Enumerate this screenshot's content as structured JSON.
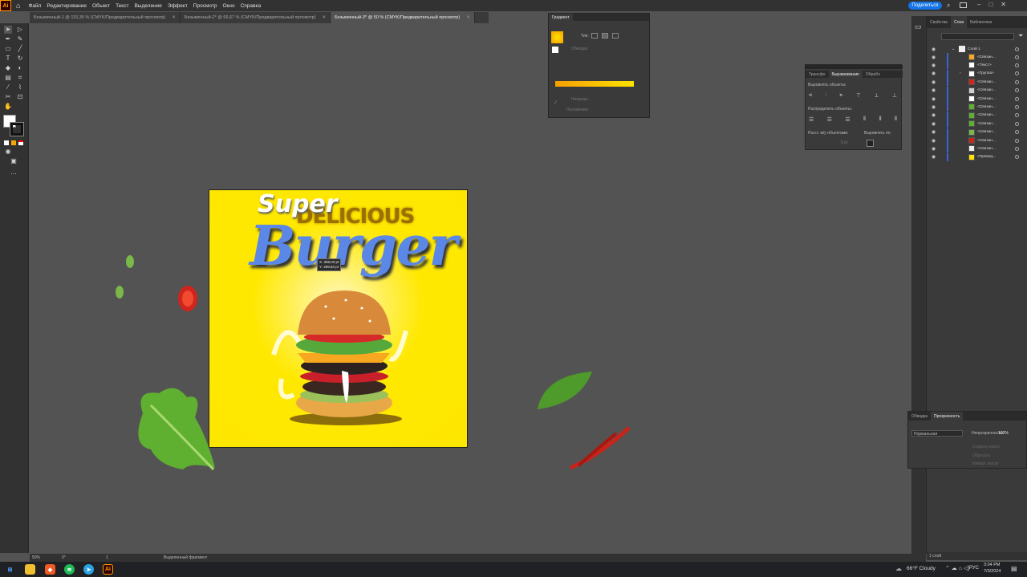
{
  "app": {
    "logo": "Ai"
  },
  "menu": [
    "Файл",
    "Редактирование",
    "Объект",
    "Текст",
    "Выделение",
    "Эффект",
    "Просмотр",
    "Окно",
    "Справка"
  ],
  "share_label": "Поделиться",
  "doc_tabs": [
    {
      "label": "Безымянный-1 @ 115,35 % (CMYK/Предварительный просмотр)"
    },
    {
      "label": "Безымянный-2* @ 66,67 % (CMYK/Предварительный просмотр)"
    },
    {
      "label": "Безымянный-3* @ 50 % (CMYK/Предварительный просмотр)"
    }
  ],
  "artwork": {
    "super": "Super",
    "delicious": "DELICIOUS",
    "burger": "Burger",
    "coord_x": "X: 358,03 pt",
    "coord_y": "Y: 289,83 pt"
  },
  "gradient_panel": {
    "title": "Градиент",
    "type_label": "Тип:",
    "stroke_label": "Обводка:",
    "opacity_label": "Непрозр.:",
    "location_label": "Положение:"
  },
  "align_panel": {
    "tabs": [
      "Трансфо",
      "Выравнивание",
      "Обрабо"
    ],
    "align_objects": "Выровнять объекты:",
    "distribute_objects": "Распределить объекты:",
    "distribute_spacing": "Расст. м/у объектами:",
    "align_to": "Выровнять по:",
    "spacing_value": "0 pt"
  },
  "layers_panel": {
    "tabs": [
      "Свойства",
      "Слои",
      "Библиотеки"
    ],
    "layer_name": "Слой 1",
    "items": [
      "<Связан...",
      "<Текст>",
      "<Группа>",
      "<Связан...",
      "<Связан...",
      "<Связан...",
      "<Связан...",
      "<Связан...",
      "<Связан...",
      "<Связан...",
      "<Связан...",
      "<Связан...",
      "<Прямоу..."
    ],
    "footer": "1 слой"
  },
  "transparency_panel": {
    "tabs": [
      "Обводка",
      "Прозрачность"
    ],
    "mode": "Нормальная",
    "opacity_label": "Непрозрачность:",
    "opacity_value": "100%",
    "make_mask": "Создать маску",
    "clip": "Обрезать",
    "invert": "Инверт. маску"
  },
  "status": {
    "zoom": "50%",
    "angle": "0°",
    "artboard_num": "1",
    "tool_hint": "Выделенный фрагмент"
  },
  "taskbar": {
    "weather": "66°F  Cloudy",
    "lang": "РУС",
    "time": "3:04 PM",
    "date": "7/3/2024"
  }
}
